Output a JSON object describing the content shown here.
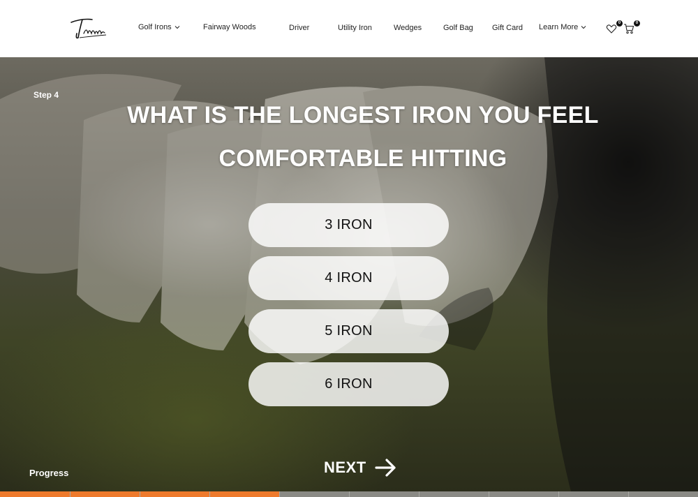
{
  "header": {
    "logo_text": "Takoma",
    "nav": [
      {
        "label": "Golf Irons",
        "has_dropdown": true
      },
      {
        "label": "Fairway Woods",
        "has_dropdown": false
      },
      {
        "label": "Driver",
        "has_dropdown": false
      },
      {
        "label": "Utility Iron",
        "has_dropdown": false
      },
      {
        "label": "Wedges",
        "has_dropdown": false
      },
      {
        "label": "Golf Bag",
        "has_dropdown": false
      },
      {
        "label": "Gift Card",
        "has_dropdown": false
      },
      {
        "label": "Learn More",
        "has_dropdown": true
      }
    ],
    "wishlist": {
      "icon": "heart-icon",
      "count": "0"
    },
    "cart": {
      "icon": "cart-icon",
      "count": "0"
    }
  },
  "quiz": {
    "step": "Step 4",
    "question": "WHAT IS THE LONGEST IRON YOU FEEL COMFORTABLE HITTING",
    "options": [
      "3 IRON",
      "4 IRON",
      "5 IRON",
      "6 IRON"
    ],
    "next_label": "NEXT",
    "progress_label": "Progress",
    "progress_fraction": 0.4,
    "progress_segments": 10
  },
  "colors": {
    "accent": "#ee7a2c",
    "header_bg": "#ffffff",
    "option_bg": "rgba(255,255,255,0.82)"
  }
}
